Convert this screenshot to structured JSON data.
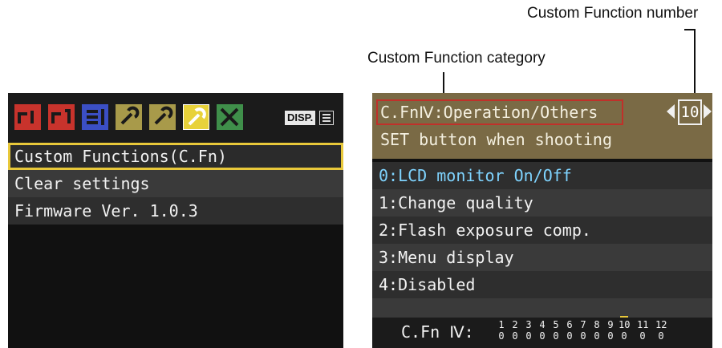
{
  "callouts": {
    "number": "Custom Function number",
    "category": "Custom Function category"
  },
  "left_screen": {
    "tabs": [
      {
        "icon": "shooting-1-icon",
        "color": "#c8332c"
      },
      {
        "icon": "shooting-2-icon",
        "color": "#c8332c"
      },
      {
        "icon": "playback-icon",
        "color": "#3b4fc4"
      },
      {
        "icon": "setup-1-icon",
        "color": "#a89a4a"
      },
      {
        "icon": "setup-2-icon",
        "color": "#a89a4a"
      },
      {
        "icon": "custom-function-icon",
        "color": "#e8d23a",
        "active": true
      },
      {
        "icon": "my-menu-icon",
        "color": "#3f8f4a"
      }
    ],
    "disp_label": "DISP.",
    "menu_items": [
      "Custom Functions(C.Fn)",
      "Clear settings",
      "Firmware Ver. 1.0.3"
    ],
    "selected_color": "#e8c83a"
  },
  "right_screen": {
    "category": "C.FnⅣ:Operation/Others",
    "function_number": "10",
    "function_name": "SET button when shooting",
    "options": [
      "0:LCD monitor On/Off",
      "1:Change quality",
      "2:Flash exposure comp.",
      "3:Menu display",
      "4:Disabled"
    ],
    "current_color": "#7fd4ff",
    "footer_label": "C.Fn Ⅳ:",
    "settings": [
      {
        "num": "1",
        "val": "0"
      },
      {
        "num": "2",
        "val": "0"
      },
      {
        "num": "3",
        "val": "0"
      },
      {
        "num": "4",
        "val": "0"
      },
      {
        "num": "5",
        "val": "0"
      },
      {
        "num": "6",
        "val": "0"
      },
      {
        "num": "7",
        "val": "0"
      },
      {
        "num": "8",
        "val": "0"
      },
      {
        "num": "9",
        "val": "0"
      },
      {
        "num": "10",
        "val": "0",
        "current": true
      },
      {
        "num": "11",
        "val": "0"
      },
      {
        "num": "12",
        "val": "0"
      }
    ]
  }
}
